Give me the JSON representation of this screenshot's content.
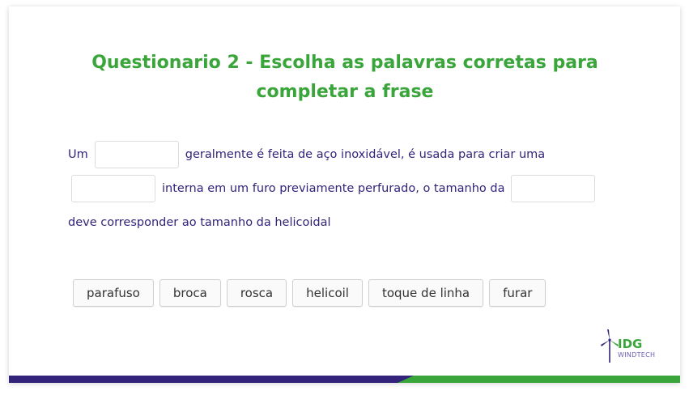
{
  "title": "Questionario 2 - Escolha as palavras corretas para completar a frase",
  "sentence": {
    "line1_a": "Um",
    "line1_b": "geralmente é feita de aço inoxidável, é usada para criar uma",
    "line2_a": "interna em um furo previamente perfurado, o tamanho da",
    "line3_a": "deve corresponder ao tamanho da helicoidal"
  },
  "options": [
    "parafuso",
    "broca",
    "rosca",
    "helicoil",
    "toque de linha",
    "furar"
  ],
  "logo": {
    "brand": "IDG",
    "sub": "WINDTECH"
  },
  "colors": {
    "title": "#3aa53a",
    "text": "#33237a",
    "bar_purple": "#33237a",
    "bar_green": "#3aa53a"
  }
}
